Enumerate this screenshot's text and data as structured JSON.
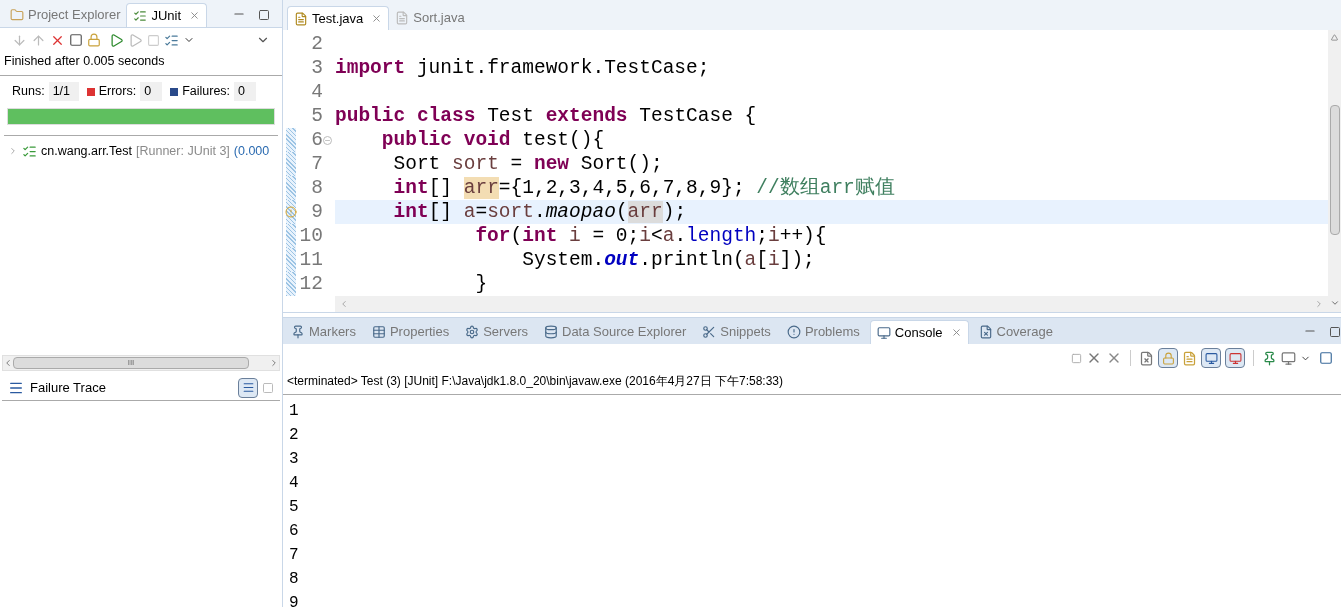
{
  "left_tabs": [
    {
      "label": "Project Explorer",
      "selected": false,
      "closable": false
    },
    {
      "label": "JUnit",
      "selected": true,
      "closable": true
    }
  ],
  "junit": {
    "status": "Finished after 0.005 seconds",
    "runs_label": "Runs:",
    "runs": "1/1",
    "errors_label": "Errors:",
    "errors": "0",
    "failures_label": "Failures:",
    "failures": "0",
    "level": 1,
    "tree": [
      {
        "name": "cn.wang.arr.Test",
        "runner": "[Runner: JUnit 3]",
        "time": "(0.000",
        "expanded": false
      }
    ],
    "scroll_grip": "III",
    "failure_trace": "Failure Trace"
  },
  "editor_tabs": [
    {
      "label": "Test.java",
      "selected": true
    },
    {
      "label": "Sort.java",
      "selected": false
    }
  ],
  "code_lines": [
    {
      "number": "2",
      "changed": false,
      "current": false,
      "foldable": false,
      "warning": false
    },
    {
      "number": "3",
      "changed": false,
      "current": false,
      "foldable": false,
      "warning": false,
      "tokens": [
        {
          "kind": "keyword",
          "text": "import"
        },
        {
          "kind": "plain",
          "text": " junit.framework.TestCase;"
        }
      ]
    },
    {
      "number": "4",
      "changed": false,
      "current": false,
      "foldable": false,
      "warning": false
    },
    {
      "number": "5",
      "changed": false,
      "current": false,
      "foldable": false,
      "warning": false,
      "tokens": [
        {
          "kind": "keyword",
          "text": "public class"
        },
        {
          "kind": "plain",
          "text": " Test "
        },
        {
          "kind": "keyword",
          "text": "extends"
        },
        {
          "kind": "plain",
          "text": " TestCase {"
        }
      ]
    },
    {
      "number": "6",
      "changed": true,
      "current": false,
      "foldable": true,
      "warning": false,
      "tokens": [
        {
          "kind": "keyword",
          "text": "    public void"
        },
        {
          "kind": "plain",
          "text": " test(){"
        }
      ]
    },
    {
      "number": "7",
      "changed": true,
      "current": false,
      "foldable": false,
      "warning": false,
      "tokens": [
        {
          "kind": "plain",
          "text": "     Sort "
        },
        {
          "kind": "local",
          "text": "sort"
        },
        {
          "kind": "plain",
          "text": " = "
        },
        {
          "kind": "keyword",
          "text": "new"
        },
        {
          "kind": "plain",
          "text": " Sort();"
        }
      ]
    },
    {
      "number": "8",
      "changed": true,
      "current": false,
      "foldable": false,
      "warning": false,
      "tokens": [
        {
          "kind": "keyword",
          "text": "     int"
        },
        {
          "kind": "plain",
          "text": "[] "
        },
        {
          "kind": "write-occurrence",
          "text": "arr"
        },
        {
          "kind": "plain",
          "text": "={1,2,3,4,5,6,7,8,9}; "
        },
        {
          "kind": "comment",
          "text": "//数组arr赋值"
        }
      ]
    },
    {
      "number": "9",
      "changed": true,
      "current": true,
      "foldable": false,
      "warning": true,
      "tokens": [
        {
          "kind": "keyword",
          "text": "     int"
        },
        {
          "kind": "plain",
          "text": "[] "
        },
        {
          "kind": "local",
          "text": "a"
        },
        {
          "kind": "plain",
          "text": "="
        },
        {
          "kind": "local",
          "text": "sort"
        },
        {
          "kind": "plain",
          "text": "."
        },
        {
          "kind": "italic",
          "text": "maopao"
        },
        {
          "kind": "plain",
          "text": "("
        },
        {
          "kind": "read-occurrence",
          "text": "arr"
        },
        {
          "kind": "plain",
          "text": ");"
        }
      ]
    },
    {
      "number": "10",
      "changed": true,
      "current": false,
      "foldable": false,
      "warning": false,
      "tokens": [
        {
          "kind": "keyword",
          "text": "            for"
        },
        {
          "kind": "plain",
          "text": "("
        },
        {
          "kind": "keyword",
          "text": "int "
        },
        {
          "kind": "local",
          "text": "i"
        },
        {
          "kind": "plain",
          "text": " = 0;"
        },
        {
          "kind": "local",
          "text": "i"
        },
        {
          "kind": "plain",
          "text": "<"
        },
        {
          "kind": "local",
          "text": "a"
        },
        {
          "kind": "plain",
          "text": "."
        },
        {
          "kind": "field",
          "text": "length"
        },
        {
          "kind": "plain",
          "text": ";"
        },
        {
          "kind": "local",
          "text": "i"
        },
        {
          "kind": "plain",
          "text": "++){"
        }
      ]
    },
    {
      "number": "11",
      "changed": true,
      "current": false,
      "foldable": false,
      "warning": false,
      "tokens": [
        {
          "kind": "plain",
          "text": "                System."
        },
        {
          "kind": "static-field",
          "text": "out"
        },
        {
          "kind": "plain",
          "text": ".println("
        },
        {
          "kind": "local",
          "text": "a"
        },
        {
          "kind": "plain",
          "text": "["
        },
        {
          "kind": "local",
          "text": "i"
        },
        {
          "kind": "plain",
          "text": "]);"
        }
      ]
    },
    {
      "number": "12",
      "changed": true,
      "current": false,
      "foldable": false,
      "warning": false,
      "tokens": [
        {
          "kind": "plain",
          "text": "            }"
        }
      ]
    }
  ],
  "bottom_tabs": [
    {
      "label": "Markers",
      "selected": false,
      "closable": false
    },
    {
      "label": "Properties",
      "selected": false,
      "closable": false
    },
    {
      "label": "Servers",
      "selected": false,
      "closable": false
    },
    {
      "label": "Data Source Explorer",
      "selected": false,
      "closable": false
    },
    {
      "label": "Snippets",
      "selected": false,
      "closable": false
    },
    {
      "label": "Problems",
      "selected": false,
      "closable": false
    },
    {
      "label": "Console",
      "selected": true,
      "closable": true
    },
    {
      "label": "Coverage",
      "selected": false,
      "closable": false
    }
  ],
  "console": {
    "scroll_lock": true,
    "show_stdout": true,
    "show_stderr": true,
    "header": "<terminated> Test (3) [JUnit] F:\\Java\\jdk1.8.0_20\\bin\\javaw.exe (2016年4月27日 下午7:58:33)",
    "lines": [
      "1",
      "2",
      "3",
      "4",
      "5",
      "6",
      "7",
      "8",
      "9"
    ]
  }
}
